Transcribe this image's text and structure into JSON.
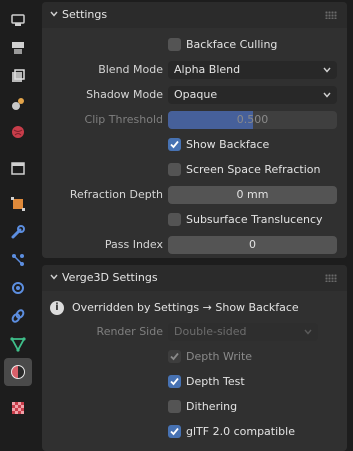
{
  "tabs": [
    {
      "name": "tool-icon",
      "active": false
    },
    {
      "name": "render-icon",
      "active": false
    },
    {
      "name": "output-icon",
      "active": false
    },
    {
      "name": "view-layer-icon",
      "active": false
    },
    {
      "name": "scene-icon",
      "active": false
    },
    {
      "name": "world-icon",
      "active": false
    },
    {
      "name": "collection-icon",
      "active": false
    },
    {
      "name": "object-icon",
      "active": false
    },
    {
      "name": "modifier-wrench-icon",
      "active": false
    },
    {
      "name": "particles-icon",
      "active": false
    },
    {
      "name": "physics-icon",
      "active": false
    },
    {
      "name": "constraints-icon",
      "active": false
    },
    {
      "name": "object-data-icon",
      "active": false
    },
    {
      "name": "material-icon",
      "active": true
    },
    {
      "name": "texture-icon",
      "active": false
    }
  ],
  "settings": {
    "title": "Settings",
    "backface_culling": {
      "label": "Backface Culling",
      "checked": false
    },
    "blend_mode": {
      "label": "Blend Mode",
      "value": "Alpha Blend"
    },
    "shadow_mode": {
      "label": "Shadow Mode",
      "value": "Opaque"
    },
    "clip_threshold": {
      "label": "Clip Threshold",
      "value": "0.500",
      "fraction": 0.5
    },
    "show_backface": {
      "label": "Show Backface",
      "checked": true
    },
    "screen_space_refraction": {
      "label": "Screen Space Refraction",
      "checked": false
    },
    "refraction_depth": {
      "label": "Refraction Depth",
      "value": "0 mm"
    },
    "subsurface_translucency": {
      "label": "Subsurface Translucency",
      "checked": false
    },
    "pass_index": {
      "label": "Pass Index",
      "value": "0"
    }
  },
  "verge3d": {
    "title": "Verge3D Settings",
    "info": "Overridden by Settings → Show Backface",
    "render_side": {
      "label": "Render Side",
      "value": "Double-sided"
    },
    "depth_write": {
      "label": "Depth Write",
      "checked": true
    },
    "depth_test": {
      "label": "Depth Test",
      "checked": true
    },
    "dithering": {
      "label": "Dithering",
      "checked": false
    },
    "gltf_compatible": {
      "label": "glTF 2.0 compatible",
      "checked": true
    }
  },
  "colors": {
    "accent": "#4772b3",
    "slider_fill": "#46609a",
    "panel": "#303030",
    "background": "#1d1d1d"
  }
}
